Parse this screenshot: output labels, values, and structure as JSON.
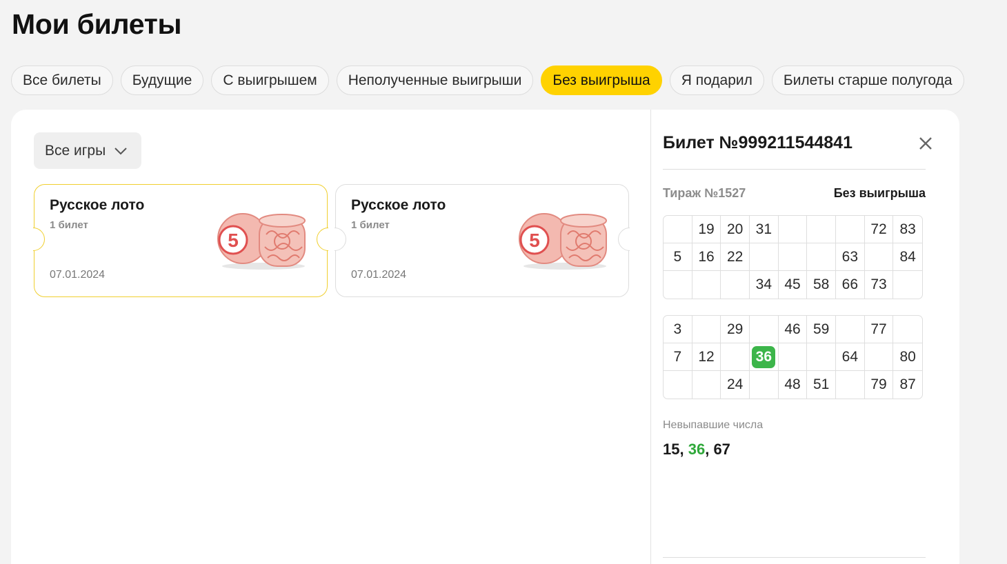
{
  "page": {
    "title": "Мои билеты"
  },
  "tabs": [
    {
      "label": "Все билеты",
      "active": false
    },
    {
      "label": "Будущие",
      "active": false
    },
    {
      "label": "С выигрышем",
      "active": false
    },
    {
      "label": "Неполученные выигрыши",
      "active": false
    },
    {
      "label": "Без выигрыша",
      "active": true
    },
    {
      "label": "Я подарил",
      "active": false
    },
    {
      "label": "Билеты старше полугода",
      "active": false
    }
  ],
  "filter": {
    "label": "Все игры",
    "icon": "chevron-down-icon"
  },
  "cards": [
    {
      "name": "Русское лото",
      "count": "1 билет",
      "date": "07.01.2024",
      "selected": true,
      "image": "lotto-kegs-illustration"
    },
    {
      "name": "Русское лото",
      "count": "1 билет",
      "date": "07.01.2024",
      "selected": false,
      "image": "lotto-kegs-illustration"
    }
  ],
  "ticket": {
    "title": "Билет №999211544841",
    "draw": "Тираж №1527",
    "result": "Без выигрыша",
    "field1": [
      [
        "",
        "19",
        "20",
        "31",
        "",
        "",
        "",
        "72",
        "83"
      ],
      [
        "5",
        "16",
        "22",
        "",
        "",
        "",
        "63",
        "",
        "84"
      ],
      [
        "",
        "",
        "",
        "34",
        "45",
        "58",
        "66",
        "73",
        ""
      ]
    ],
    "field2": [
      [
        "3",
        "",
        "29",
        "",
        "46",
        "59",
        "",
        "77",
        ""
      ],
      [
        "7",
        "12",
        "",
        "36",
        "",
        "",
        "64",
        "",
        "80"
      ],
      [
        "",
        "",
        "24",
        "",
        "48",
        "51",
        "",
        "79",
        "87"
      ]
    ],
    "highlighted": [
      "36"
    ],
    "missing_label": "Невыпавшие числа",
    "missing_numbers": [
      "15",
      "36",
      "67"
    ],
    "missing_separator": ", "
  },
  "colors": {
    "accent": "#ffd200",
    "hit": "#3cb54a",
    "ball": "#e05050"
  }
}
